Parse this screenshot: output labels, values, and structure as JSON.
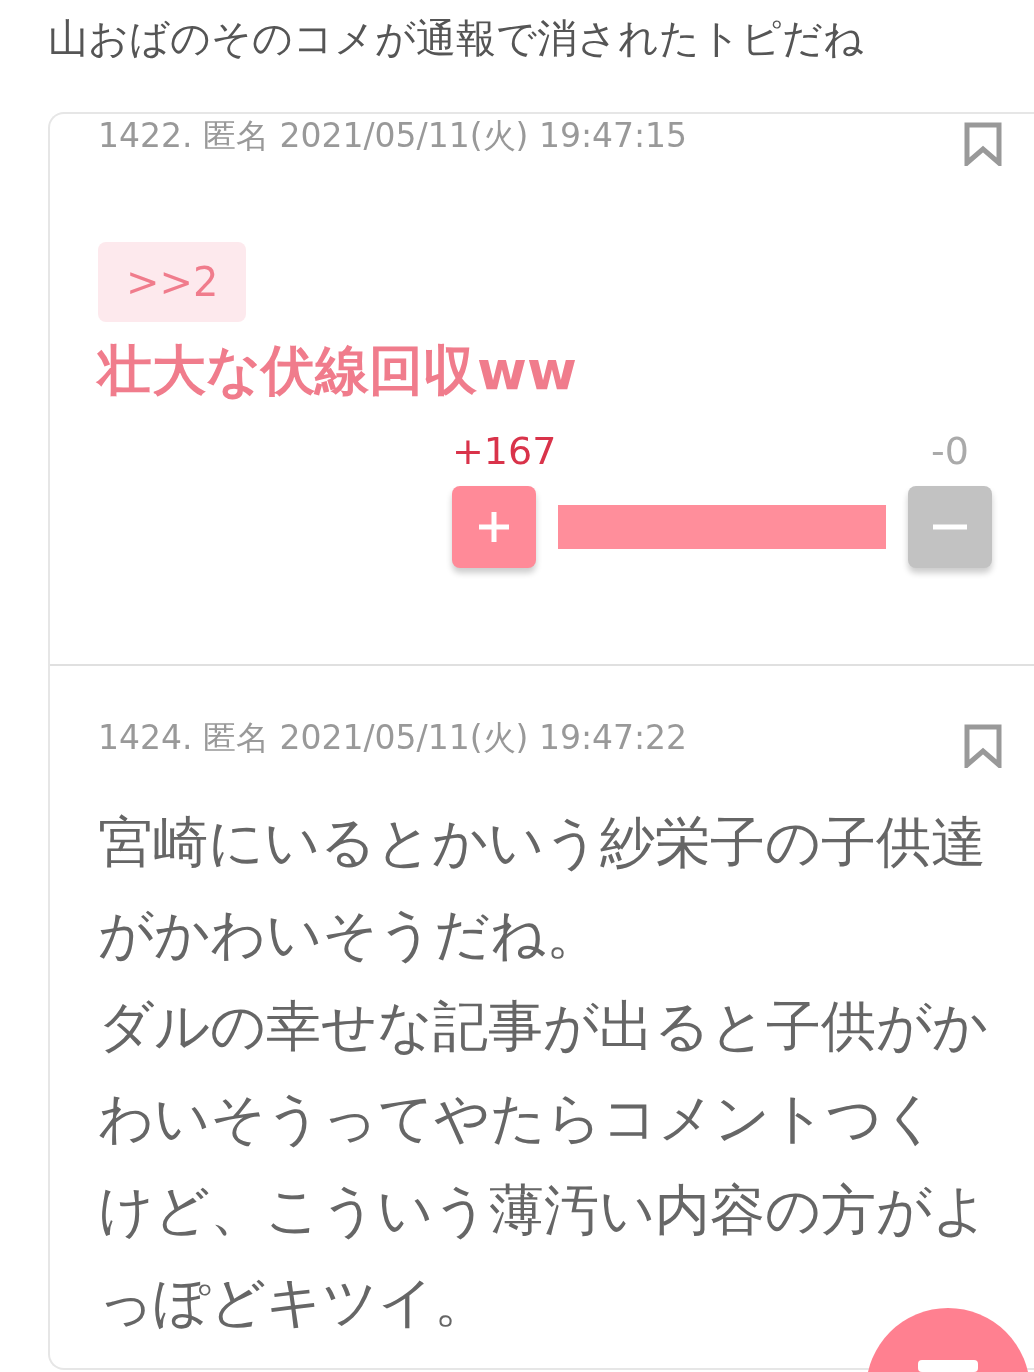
{
  "page_title": "山おばのそのコメが通報で消されたトピだね",
  "comments": [
    {
      "kind": "reply",
      "meta": "1422. 匿名 2021/05/11(火) 19:47:15",
      "anchor": ">>2",
      "body": "壮大な伏線回収ww",
      "votes": {
        "plus": "+167",
        "minus": "-0",
        "level": 1
      }
    },
    {
      "kind": "plain",
      "meta": "1424. 匿名 2021/05/11(火) 19:47:22",
      "paragraphs": [
        "宮崎にいるとかいう紗栄子の子供達がかわいそうだね。",
        "ダルの幸せな記事が出ると子供がかわいそうってやたらコメントつくけど、こういう薄汚い内容の方がよっぽどキツイ。"
      ]
    }
  ]
}
